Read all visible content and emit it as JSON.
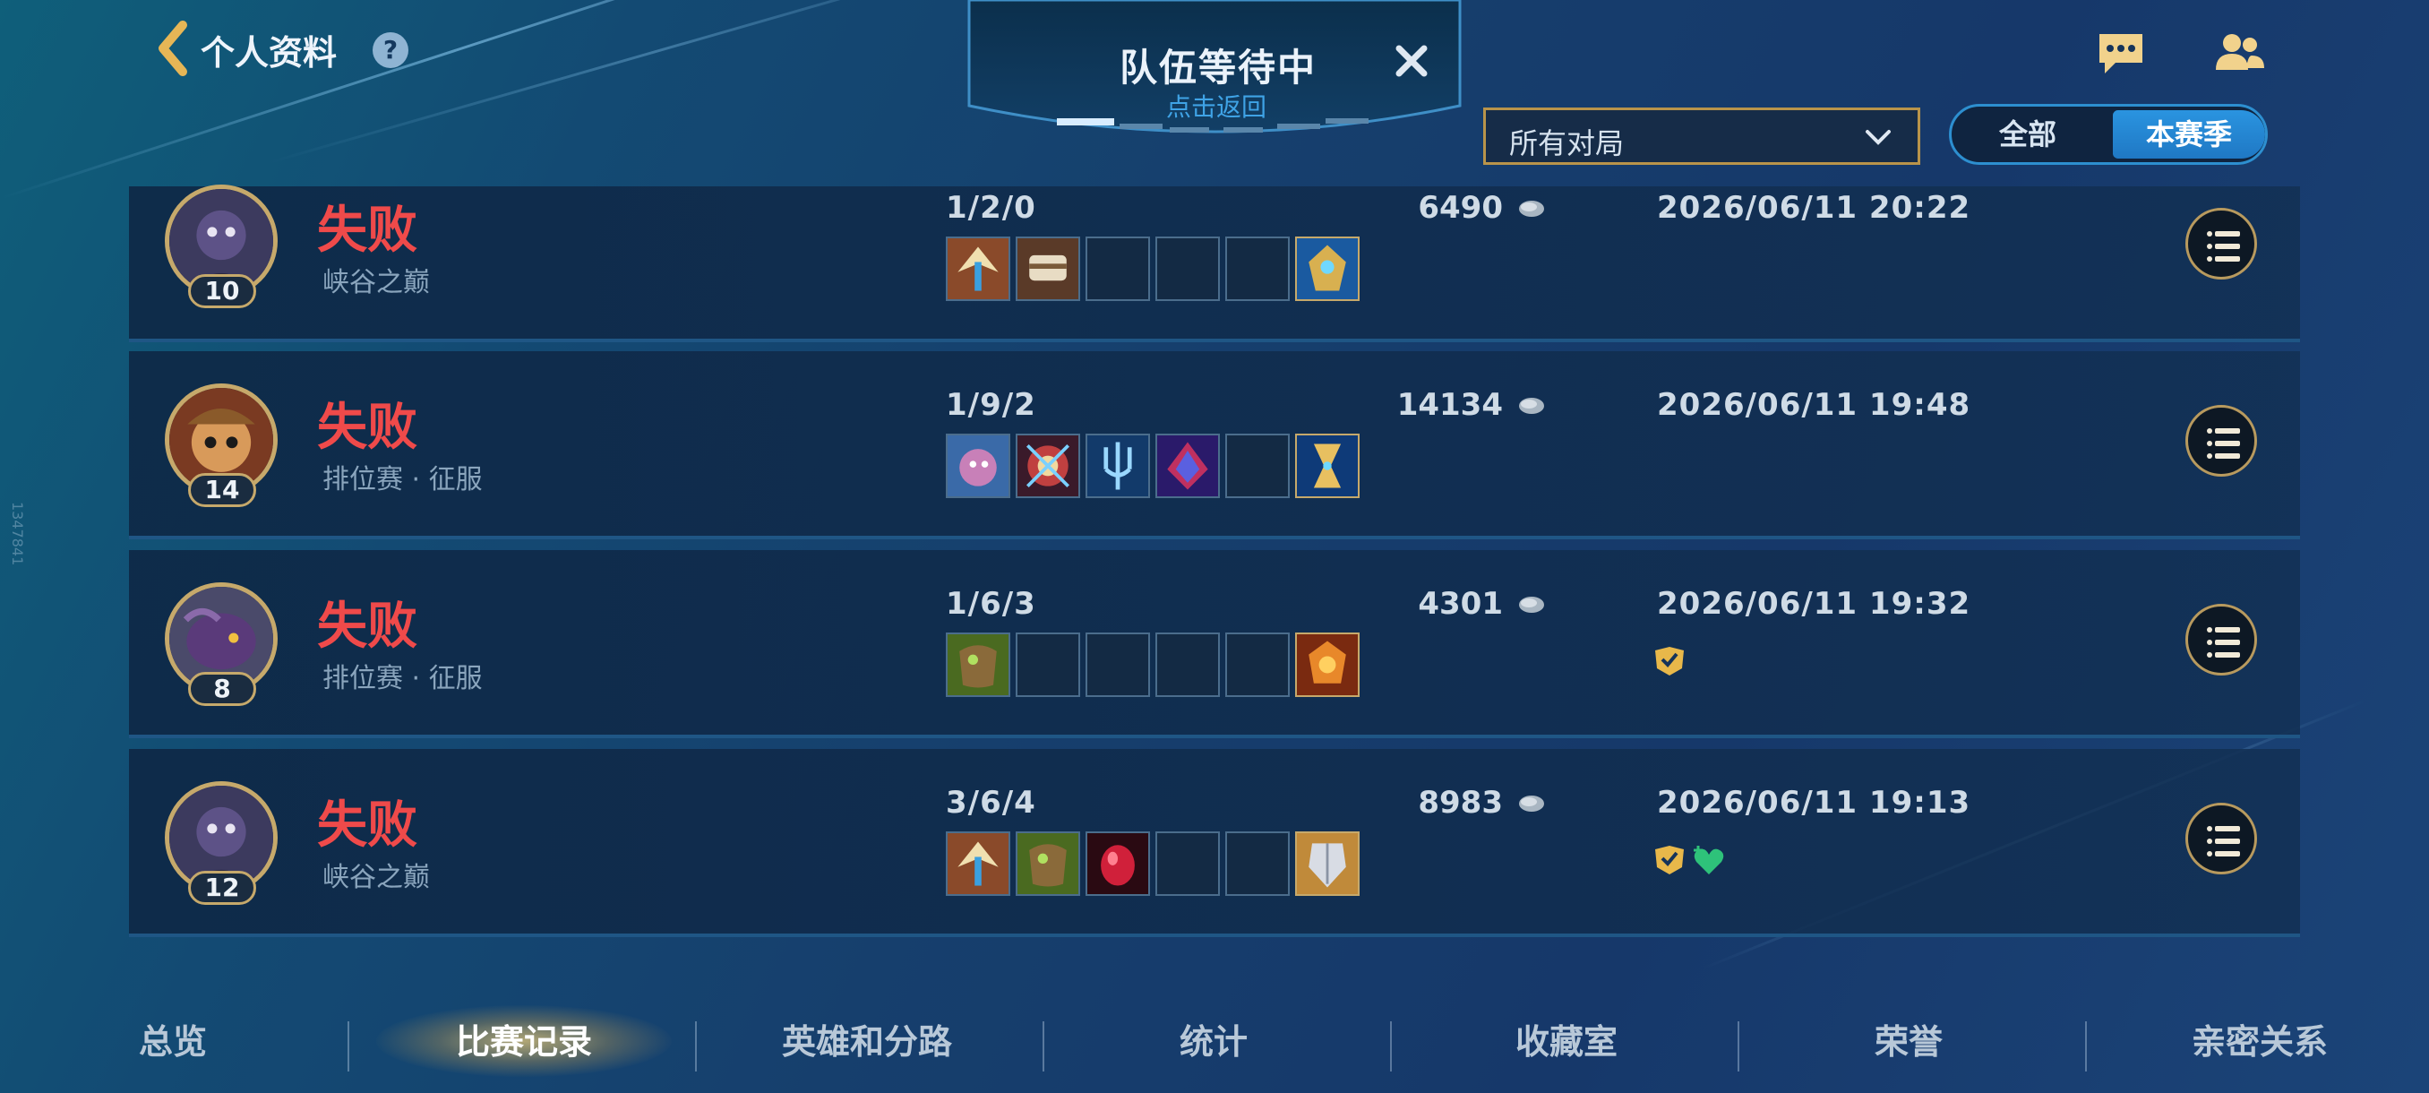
{
  "header": {
    "title": "个人资料",
    "help_symbol": "?",
    "queue_title": "队伍等待中",
    "queue_subtitle": "点击返回",
    "icons": [
      "back-arrow-icon",
      "help-icon",
      "close-icon",
      "chat-icon",
      "friends-icon"
    ]
  },
  "filter": {
    "selected": "所有对局"
  },
  "season_toggle": {
    "all_label": "全部",
    "season_label": "本赛季",
    "active": "本赛季"
  },
  "matches": [
    {
      "result": "失败",
      "mode": "峡谷之巅",
      "level": "10",
      "kda": "1/2/0",
      "gold": "6490",
      "date": "2026/06/11 20:22",
      "items": [
        "item-wings",
        "item-boots",
        "",
        "",
        ""
      ],
      "trinket": "item-gold-armor",
      "badges": []
    },
    {
      "result": "失败",
      "mode": "排位赛 · 征服",
      "level": "14",
      "kda": "1/9/2",
      "gold": "14134",
      "date": "2026/06/11 19:48",
      "items": [
        "item-portrait",
        "item-orb",
        "item-trident",
        "item-crystal",
        ""
      ],
      "trinket": "item-hourglass",
      "badges": []
    },
    {
      "result": "失败",
      "mode": "排位赛 · 征服",
      "level": "8",
      "kda": "1/6/3",
      "gold": "4301",
      "date": "2026/06/11 19:32",
      "items": [
        "item-bark-armor",
        "",
        "",
        "",
        ""
      ],
      "trinket": "item-flame-shield",
      "badges": [
        "gold-badge-icon"
      ]
    },
    {
      "result": "失败",
      "mode": "峡谷之巅",
      "level": "12",
      "kda": "3/6/4",
      "gold": "8983",
      "date": "2026/06/11 19:13",
      "items": [
        "item-wings",
        "item-bark-armor",
        "item-ruby",
        "",
        ""
      ],
      "trinket": "item-plate-armor",
      "badges": [
        "gold-badge-icon",
        "heal-heart-icon"
      ]
    }
  ],
  "bottom_nav": {
    "tabs": [
      "总览",
      "比赛记录",
      "英雄和分路",
      "统计",
      "收藏室",
      "荣誉",
      "亲密关系"
    ],
    "active": "比赛记录"
  },
  "side_watermark": "1347841",
  "colors": {
    "defeat": "#ef4a4a",
    "accent_gold": "#c6a96b",
    "active_tab_blue": "#2a94e0"
  }
}
